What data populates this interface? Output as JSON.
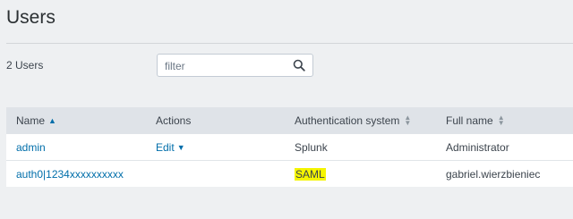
{
  "page": {
    "title": "Users"
  },
  "summary": {
    "count_text": "2 Users"
  },
  "filter": {
    "placeholder": "filter",
    "value": ""
  },
  "table": {
    "headers": {
      "name": "Name",
      "actions": "Actions",
      "auth_system": "Authentication system",
      "full_name": "Full name"
    },
    "rows": [
      {
        "name": "admin",
        "action": "Edit",
        "auth_system": "Splunk",
        "full_name": "Administrator"
      },
      {
        "name": "auth0|1234xxxxxxxxxx",
        "action": "",
        "auth_system": "SAML",
        "full_name": "gabriel.wierzbieniec"
      }
    ]
  },
  "colors": {
    "link": "#006eaa",
    "highlight": "#f5f500",
    "header_bg": "#dfe3e8",
    "page_bg": "#eef0f2"
  },
  "icons": {
    "filter": "search-icon",
    "sort_active": "sort-ascending-icon",
    "sort_inactive": "sort-icon",
    "dropdown": "caret-down-icon"
  }
}
